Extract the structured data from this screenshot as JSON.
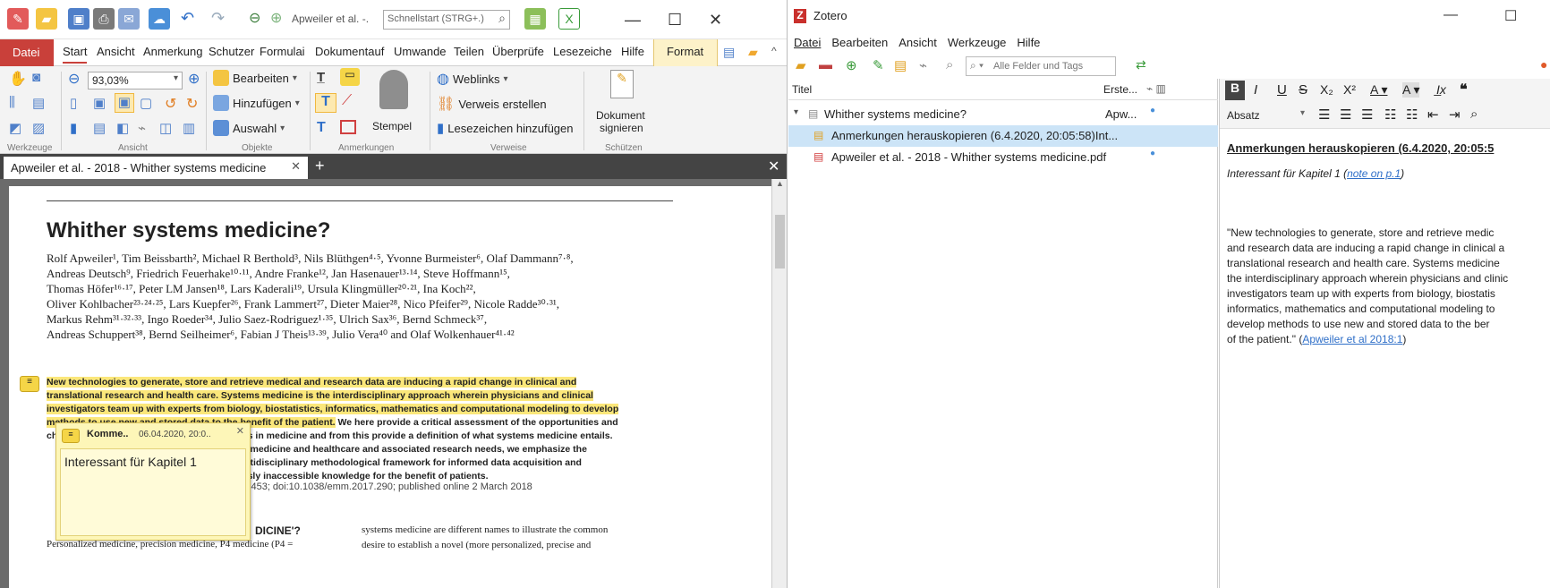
{
  "pdf_app": {
    "quick_access": {
      "title": "Apweiler et al. -.",
      "search_placeholder": "Schnellstart (STRG+.)"
    },
    "ribbon_tabs": [
      "Datei",
      "Start",
      "Ansicht",
      "Anmerkung",
      "Schutzer",
      "Formulai",
      "Dokumentauf",
      "Umwande",
      "Teilen",
      "Überprüfe",
      "Lesezeiche",
      "Hilfe",
      "Format"
    ],
    "ribbon": {
      "zoom_value": "93,03%",
      "edit_label": "Bearbeiten",
      "add_label": "Hinzufügen",
      "select_label": "Auswahl",
      "stamp_label": "Stempel",
      "weblinks_label": "Weblinks",
      "create_link_label": "Verweis erstellen",
      "add_bookmark_label": "Lesezeichen hinzufügen",
      "sign_line1": "Dokument",
      "sign_line2": "signieren",
      "groups": [
        "Werkzeuge",
        "Ansicht",
        "Objekte",
        "Anmerkungen",
        "Verweise",
        "Schützen"
      ]
    },
    "doc_tab": "Apweiler et al. - 2018 - Whither systems medicine",
    "page": {
      "title": "Whither systems medicine?",
      "authors": [
        "Rolf Apweiler¹, Tim Beissbarth², Michael R Berthold³, Nils Blüthgen⁴·⁵, Yvonne Burmeister⁶, Olaf Dammann⁷·⁸,",
        "Andreas Deutsch⁹, Friedrich Feuerhake¹⁰·¹¹, Andre Franke¹², Jan Hasenauer¹³·¹⁴, Steve Hoffmann¹⁵,",
        "Thomas Höfer¹⁶·¹⁷, Peter LM Jansen¹⁸, Lars Kaderali¹⁹, Ursula Klingmüller²⁰·²¹, Ina Koch²²,",
        "Oliver Kohlbacher²³·²⁴·²⁵, Lars Kuepfer²⁶, Frank Lammert²⁷, Dieter Maier²⁸, Nico Pfeifer²⁹, Nicole Radde³⁰·³¹,",
        "Markus Rehm³¹·³²·³³, Ingo Roeder³⁴, Julio Saez-Rodriguez¹·³⁵, Ulrich Sax³⁶, Bernd Schmeck³⁷,",
        "Andreas Schuppert³⁸, Bernd Seilheimer⁶, Fabian J Theis¹³·³⁹, Julio Vera⁴⁰ and Olaf Wolkenhauer⁴¹·⁴²"
      ],
      "abstract_hl": [
        "New technologies to generate, store and retrieve medical and research data are inducing a rapid change in clinical and",
        "translational research and health care. Systems medicine is the interdisciplinary approach wherein physicians and clinical",
        "investigators team up with experts from biology, biostatistics, informatics, mathematics and computational modeling to develop",
        "methods to use new and stored data to the benefit of the patient."
      ],
      "abstract_rest_1": " We here provide a critical assessment of the opportunities and",
      "abstract_2": "challenges arising out of systems approaches in medicine and from this provide a definition of what systems medicine entails.",
      "abstract_3": "ts in medicine and healthcare and associated research needs, we emphasize the",
      "abstract_4": "l multidisciplinary methodological framework for informed data acquisition and",
      "abstract_5": "viously inaccessible knowledge for the benefit of patients.",
      "citation": "50, e453; doi:10.1038/emm.2017.290; published online 2 March 2018",
      "section_heading": "DICINE'?",
      "col_left": "Personalized medicine, precision medicine, P4 medicine (P4 =",
      "col_right_1": "systems medicine are different names to illustrate the common",
      "col_right_2": "desire to establish a novel (more personalized, precise and"
    },
    "popup": {
      "title": "Komme..",
      "date": "06.04.2020, 20:0..",
      "text": "Interessant für Kapitel 1"
    }
  },
  "zotero": {
    "title": "Zotero",
    "menu": [
      "Datei",
      "Bearbeiten",
      "Ansicht",
      "Werkzeuge",
      "Hilfe"
    ],
    "search_placeholder": "Alle Felder und Tags",
    "columns": {
      "title": "Titel",
      "creator": "Erste..."
    },
    "items": [
      {
        "title": "Whither systems medicine?",
        "creator": "Apw..."
      },
      {
        "title": "Anmerkungen herauskopieren (6.4.2020, 20:05:58)Int..."
      },
      {
        "title": "Apweiler et al. - 2018 - Whither systems medicine.pdf"
      }
    ],
    "editor": {
      "format_select": "Absatz",
      "note_title": "Anmerkungen herauskopieren (6.4.2020, 20:05:5",
      "note_sub_1": "Interessant für Kapitel 1 (",
      "note_sub_link": "note on p.1",
      "note_sub_2": ")",
      "quote_lines": [
        "\"New technologies to generate, store and retrieve medic",
        "and research data are inducing a rapid change in clinical a",
        "translational research and health care. Systems medicine",
        "the interdisciplinary approach wherein physicians and clinic",
        "investigators team up with experts from biology, biostatis",
        "informatics, mathematics and computational modeling to",
        "develop methods to use new and stored data to the ber",
        "of the patient.\" ("
      ],
      "quote_cite": "Apweiler et al 2018:1",
      "quote_end": ")"
    }
  }
}
